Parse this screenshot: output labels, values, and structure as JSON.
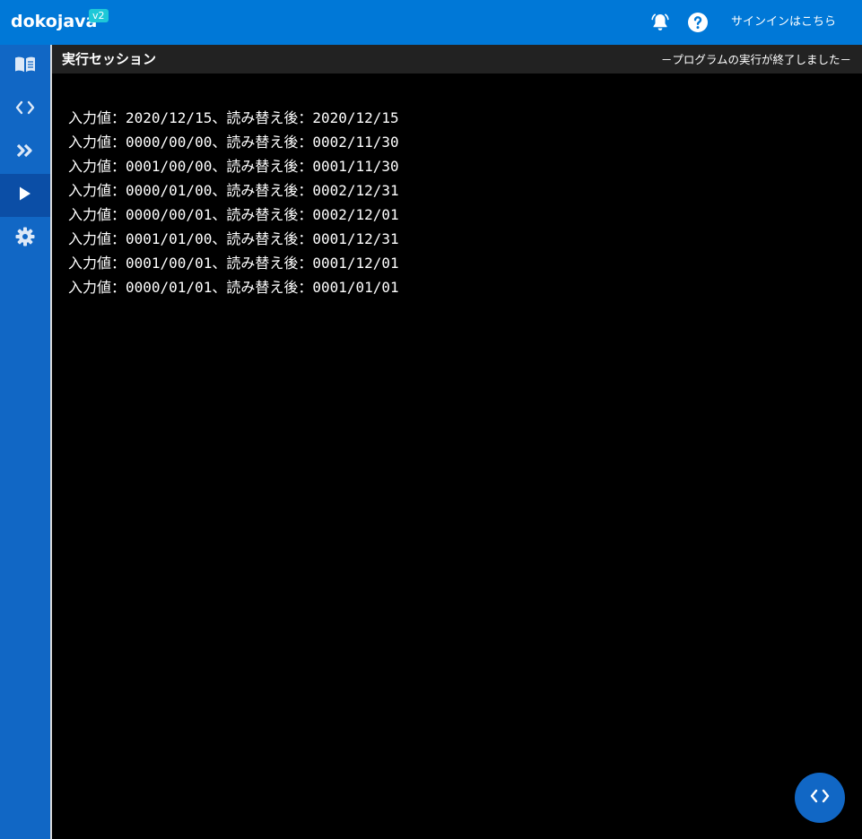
{
  "header": {
    "brand": "dokojava",
    "version": "v2",
    "notifications_icon": "bell-icon",
    "help_icon": "question-circle-icon",
    "signin_label": "サインインはこちら"
  },
  "sidebar": {
    "items": [
      {
        "name": "book-icon",
        "active": false
      },
      {
        "name": "code-icon",
        "active": false
      },
      {
        "name": "double-chevron-icon",
        "active": false
      },
      {
        "name": "play-icon",
        "active": true
      },
      {
        "name": "gear-icon",
        "active": false
      }
    ]
  },
  "panel": {
    "title": "実行セッション",
    "status": "－プログラムの実行が終了しました－"
  },
  "console": {
    "lines": [
      "入力値：2020/12/15、読み替え後：2020/12/15",
      "入力値：0000/00/00、読み替え後：0002/11/30",
      "入力値：0001/00/00、読み替え後：0001/11/30",
      "入力値：0000/01/00、読み替え後：0002/12/31",
      "入力値：0000/00/01、読み替え後：0002/12/01",
      "入力値：0001/01/00、読み替え後：0001/12/31",
      "入力値：0001/00/01、読み替え後：0001/12/01",
      "入力値：0000/01/01、読み替え後：0001/01/01"
    ]
  },
  "fab": {
    "icon": "code-icon"
  },
  "colors": {
    "topbar": "#0078d7",
    "sidebar": "#1167c5",
    "sidebar_active": "#0b4ea6",
    "badge": "#1ec8d8",
    "console_bg": "#000000",
    "header_bg": "#222222"
  }
}
